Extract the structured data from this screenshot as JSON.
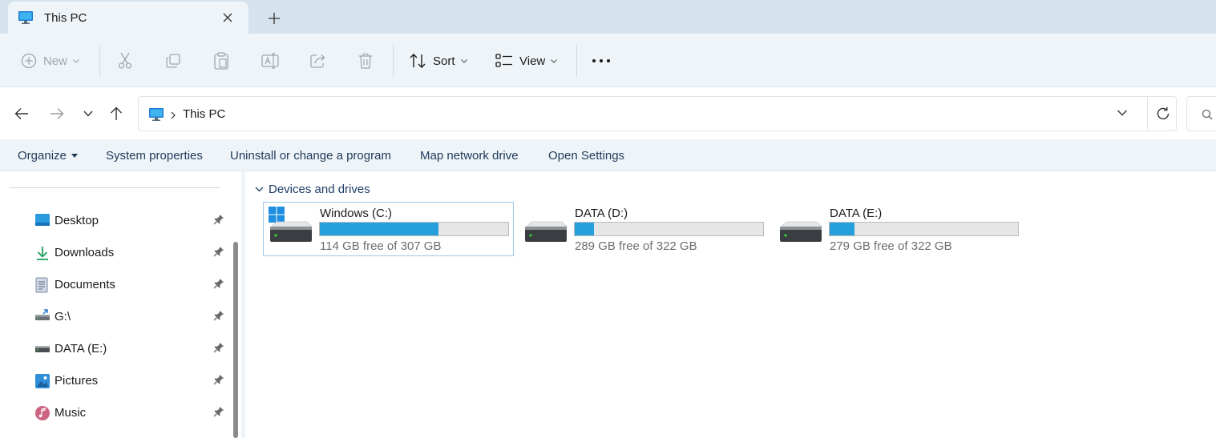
{
  "tab": {
    "title": "This PC",
    "icon": "monitor-icon"
  },
  "toolbar": {
    "new_label": "New",
    "sort_label": "Sort",
    "view_label": "View"
  },
  "address": {
    "path": "This PC"
  },
  "links": {
    "organize": "Organize",
    "system_properties": "System properties",
    "uninstall": "Uninstall or change a program",
    "map_drive": "Map network drive",
    "open_settings": "Open Settings"
  },
  "sidebar": {
    "items": [
      {
        "label": "Desktop",
        "icon": "desktop-icon"
      },
      {
        "label": "Downloads",
        "icon": "download-icon"
      },
      {
        "label": "Documents",
        "icon": "document-icon"
      },
      {
        "label": "G:\\",
        "icon": "network-drive-icon"
      },
      {
        "label": "DATA (E:)",
        "icon": "drive-icon"
      },
      {
        "label": "Pictures",
        "icon": "pictures-icon"
      },
      {
        "label": "Music",
        "icon": "music-icon"
      }
    ]
  },
  "main": {
    "group_label": "Devices and drives",
    "drives": [
      {
        "name": "Windows (C:)",
        "free_text": "114 GB free of 307 GB",
        "used_fraction": 0.629
      },
      {
        "name": "DATA (D:)",
        "free_text": "289 GB free of 322 GB",
        "used_fraction": 0.102
      },
      {
        "name": "DATA (E:)",
        "free_text": "279 GB free of 322 GB",
        "used_fraction": 0.134
      }
    ]
  },
  "colors": {
    "accent": "#26a0da",
    "tab_strip": "#d4e3ed",
    "command_bar": "#eef4f8"
  }
}
